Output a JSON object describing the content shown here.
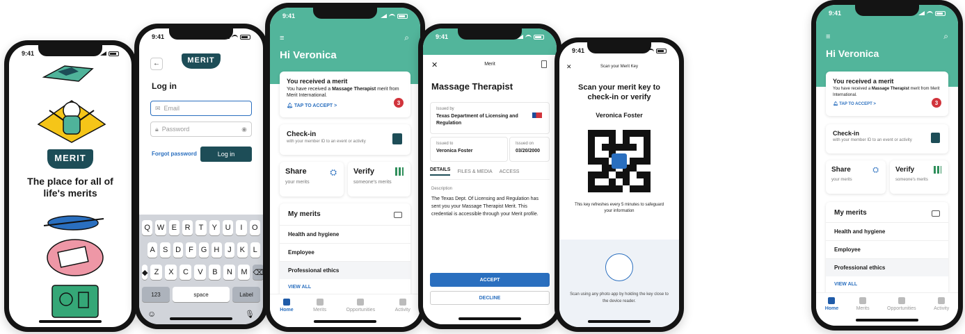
{
  "status_time": "9:41",
  "colors": {
    "teal": "#52b59b",
    "navy": "#1d4d57",
    "blue": "#2a6fbf",
    "red": "#d1343c"
  },
  "icons": [
    "back-arrow-icon",
    "mail-icon",
    "lock-icon",
    "eye-icon",
    "filter-icon",
    "search-icon",
    "bell-icon",
    "id-card-icon",
    "users-icon",
    "qr-icon",
    "wallet-icon",
    "close-icon",
    "trash-icon",
    "flag-icon",
    "home-icon",
    "merits-icon",
    "opportunities-icon",
    "activity-icon",
    "shift-icon",
    "delete-icon",
    "emoji-icon",
    "mic-icon"
  ],
  "welcome": {
    "logo": "MERIT",
    "tagline": "The place for all of life's merits"
  },
  "login": {
    "logo": "MERIT",
    "title": "Log in",
    "email_placeholder": "Email",
    "password_placeholder": "Password",
    "forgot": "Forgot password",
    "login_button": "Log in",
    "keyboard": {
      "row1": [
        "Q",
        "W",
        "E",
        "R",
        "T",
        "Y",
        "U",
        "I",
        "O"
      ],
      "row2": [
        "A",
        "S",
        "D",
        "F",
        "G",
        "H",
        "J",
        "K",
        "L"
      ],
      "row3": [
        "Z",
        "X",
        "C",
        "V",
        "B",
        "N",
        "M"
      ],
      "num": "123",
      "space": "space",
      "label": "Label"
    }
  },
  "home": {
    "greeting": "Hi Veronica",
    "notice_title": "You received a merit",
    "notice_text_pre": "You have received a ",
    "notice_text_bold": "Massage Therapist",
    "notice_text_post": " merit from Merit International.",
    "tap_accept": "TAP TO ACCEPT >",
    "badge": "3",
    "checkin_title": "Check-in",
    "checkin_sub": "with your member ID to an event or activity",
    "share_title": "Share",
    "share_sub": "your merits",
    "verify_title": "Verify",
    "verify_sub": "someone's merits",
    "my_merits": "My merits",
    "merits": [
      "Health and hygiene",
      "Employee",
      "Professional ethics"
    ],
    "view_all": "VIEW ALL",
    "tabs": [
      "Home",
      "Merits",
      "Opportunities",
      "Activity"
    ]
  },
  "merit_detail": {
    "header": "Merit",
    "title": "Massage Therapist",
    "issued_by_label": "Issued by",
    "issued_by": "Texas Department of Licensing and Regulation",
    "issued_to_label": "Issued to",
    "issued_to": "Veronica Foster",
    "issued_on_label": "Issued on",
    "issued_on": "03/20/2000",
    "tabs": [
      "DETAILS",
      "FILES & MEDIA",
      "ACCESS"
    ],
    "desc_label": "Description",
    "desc": "The Texas Dept. Of Licensing and Regulation has sent you your Massage Therapist Merit. This credential is accessible through your Merit profile.",
    "accept": "ACCEPT",
    "decline": "DECLINE"
  },
  "scan": {
    "header": "Scan your Merit Key",
    "title": "Scan your merit key to check-in or verify",
    "name": "Veronica Foster",
    "note": "This key refreshes every 5 minutes to safeguard your information",
    "instructions": "Scan using any photo app by holding the key close to the device reader."
  }
}
